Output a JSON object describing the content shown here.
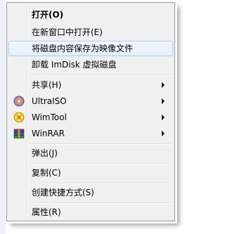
{
  "menu": {
    "items": [
      {
        "label": "打开(O)",
        "bold": true
      },
      {
        "label": "在新窗口中打开(E)"
      },
      {
        "label": "将磁盘内容保存为映像文件",
        "highlighted": true
      },
      {
        "label": "卸载 ImDisk 虚拟磁盘"
      },
      {
        "label": "共享(H)",
        "submenu": true
      },
      {
        "label": "UltraISO",
        "submenu": true,
        "icon": "ultraiso-disc-icon"
      },
      {
        "label": "WimTool",
        "submenu": true,
        "icon": "wimtool-icon"
      },
      {
        "label": "WinRAR",
        "submenu": true,
        "icon": "winrar-books-icon"
      },
      {
        "label": "弹出(J)"
      },
      {
        "label": "复制(C)"
      },
      {
        "label": "创建快捷方式(S)"
      },
      {
        "label": "属性(R)"
      }
    ]
  },
  "colors": {
    "menu_background": "#f0f0f0",
    "menu_border": "#979797",
    "highlight_border": "#aeccf0",
    "highlight_fill": "#e4effb"
  }
}
